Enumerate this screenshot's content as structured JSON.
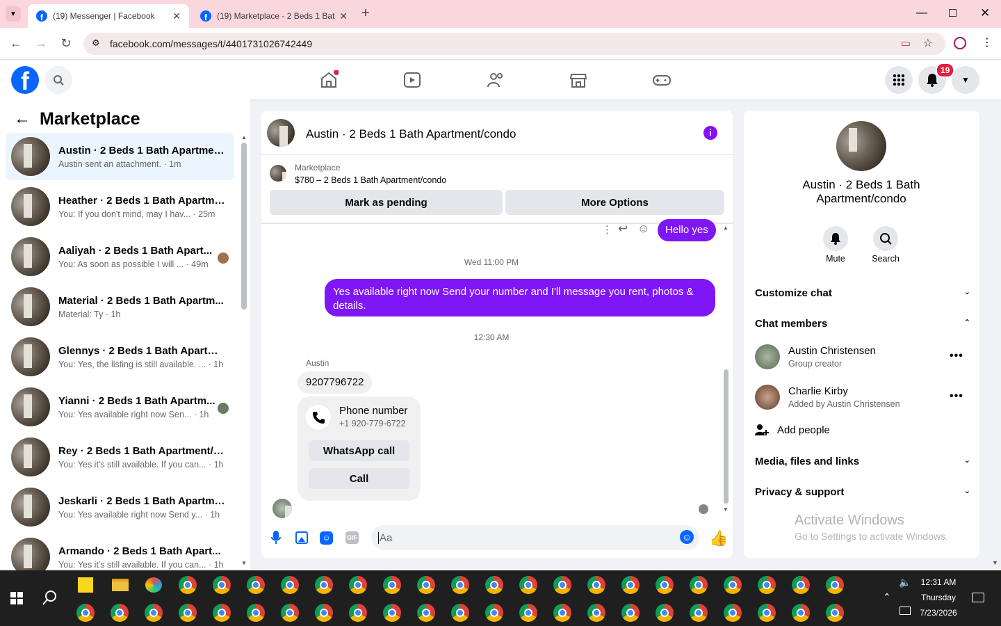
{
  "browser": {
    "tabs": [
      {
        "title": "(19) Messenger | Facebook"
      },
      {
        "title": "(19) Marketplace - 2 Beds 1 Bat"
      }
    ],
    "url": "facebook.com/messages/t/4401731026742449"
  },
  "header": {
    "notif_count": "19"
  },
  "left": {
    "title": "Marketplace",
    "conversations": [
      {
        "name": "Austin · 2 Beds 1 Bath Apartmen...",
        "sub": "Austin sent an attachment. · 1m"
      },
      {
        "name": "Heather · 2 Beds 1 Bath Apartme...",
        "sub": "You: If you don't mind, may I hav... · 25m"
      },
      {
        "name": "Aaliyah · 2 Beds 1 Bath Apart...",
        "sub": "You: As soon as possible I will ... · 49m"
      },
      {
        "name": "Material · 2 Beds 1 Bath Apartm...",
        "sub": "Material: Ty · 1h"
      },
      {
        "name": "Glennys · 2 Beds 1 Bath Apartme...",
        "sub": "You: Yes, the listing is still available. ... · 1h"
      },
      {
        "name": "Yianni · 2 Beds 1 Bath Apartm...",
        "sub": "You: Yes available right now Sen... · 1h"
      },
      {
        "name": "Rey · 2 Beds 1 Bath Apartment/c...",
        "sub": "You: Yes it's still available. If you can... · 1h"
      },
      {
        "name": "Jeskarli · 2 Beds 1 Bath Apartme...",
        "sub": "You: Yes available right now Send y... · 1h"
      },
      {
        "name": "Armando · 2 Beds 1 Bath Apart...",
        "sub": "You: Yes it's still available. If you can... · 1h"
      }
    ]
  },
  "chat": {
    "title": "Austin · 2 Beds 1 Bath Apartment/condo",
    "listing_label": "Marketplace",
    "listing_price": "$780 – 2 Beds 1 Bath Apartment/condo",
    "mark_pending": "Mark as pending",
    "more_options": "More Options",
    "msg_hello": "Hello yes",
    "time1": "Wed 11:00 PM",
    "msg_available": "Yes available right now Send your number and I'll message you rent, photos & details.",
    "time2": "12:30 AM",
    "sender": "Austin",
    "msg_number": "9207796722",
    "card_title": "Phone number",
    "card_number": "+1 920-779-6722",
    "whatsapp": "WhatsApp call",
    "call": "Call",
    "input_placeholder": "Aa"
  },
  "right": {
    "title": "Austin · 2 Beds 1 Bath Apartment/condo",
    "mute": "Mute",
    "search": "Search",
    "customize": "Customize chat",
    "members_header": "Chat members",
    "members": [
      {
        "name": "Austin Christensen",
        "role": "Group creator"
      },
      {
        "name": "Charlie Kirby",
        "role": "Added by Austin Christensen"
      }
    ],
    "add_people": "Add people",
    "media": "Media, files and links",
    "privacy": "Privacy & support",
    "watermark_title": "Activate Windows",
    "watermark_sub": "Go to Settings to activate Windows."
  },
  "taskbar": {
    "time": "12:31 AM",
    "day": "Thursday",
    "date": "7/23/2026"
  }
}
